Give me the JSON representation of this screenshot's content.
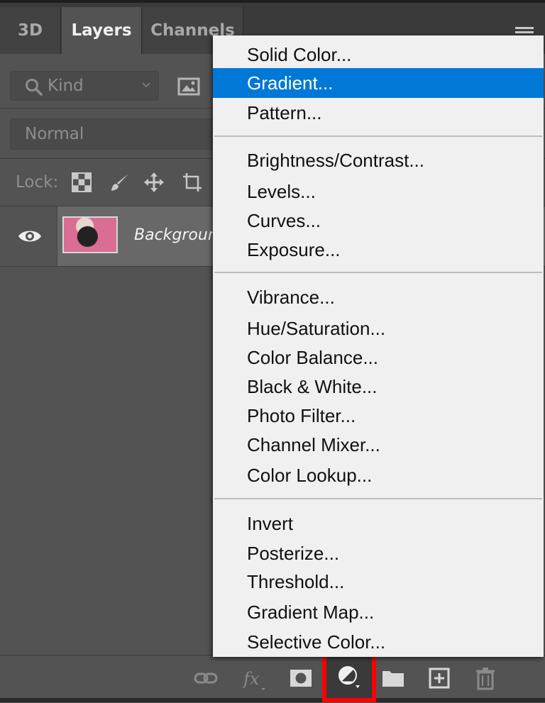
{
  "tabs": [
    {
      "label": "3D",
      "active": false
    },
    {
      "label": "Layers",
      "active": true
    },
    {
      "label": "Channels",
      "active": false
    }
  ],
  "filter": {
    "kind_label": "Kind"
  },
  "blend_mode": "Normal",
  "lock": {
    "label": "Lock:"
  },
  "layer": {
    "name": "Background",
    "visible": true
  },
  "menu": {
    "selected": "Gradient...",
    "groups": [
      [
        "Solid Color...",
        "Gradient...",
        "Pattern..."
      ],
      [
        "Brightness/Contrast...",
        "Levels...",
        "Curves...",
        "Exposure..."
      ],
      [
        "Vibrance...",
        "Hue/Saturation...",
        "Color Balance...",
        "Black & White...",
        "Photo Filter...",
        "Channel Mixer...",
        "Color Lookup..."
      ],
      [
        "Invert",
        "Posterize...",
        "Threshold...",
        "Gradient Map...",
        "Selective Color..."
      ]
    ]
  },
  "bottom_icons": [
    "link-layers-icon",
    "fx-icon",
    "add-mask-icon",
    "adjustment-layer-icon",
    "new-group-icon",
    "new-layer-icon",
    "delete-layer-icon"
  ],
  "colors": {
    "highlight": "#0078d7",
    "callout": "#ff0000"
  }
}
